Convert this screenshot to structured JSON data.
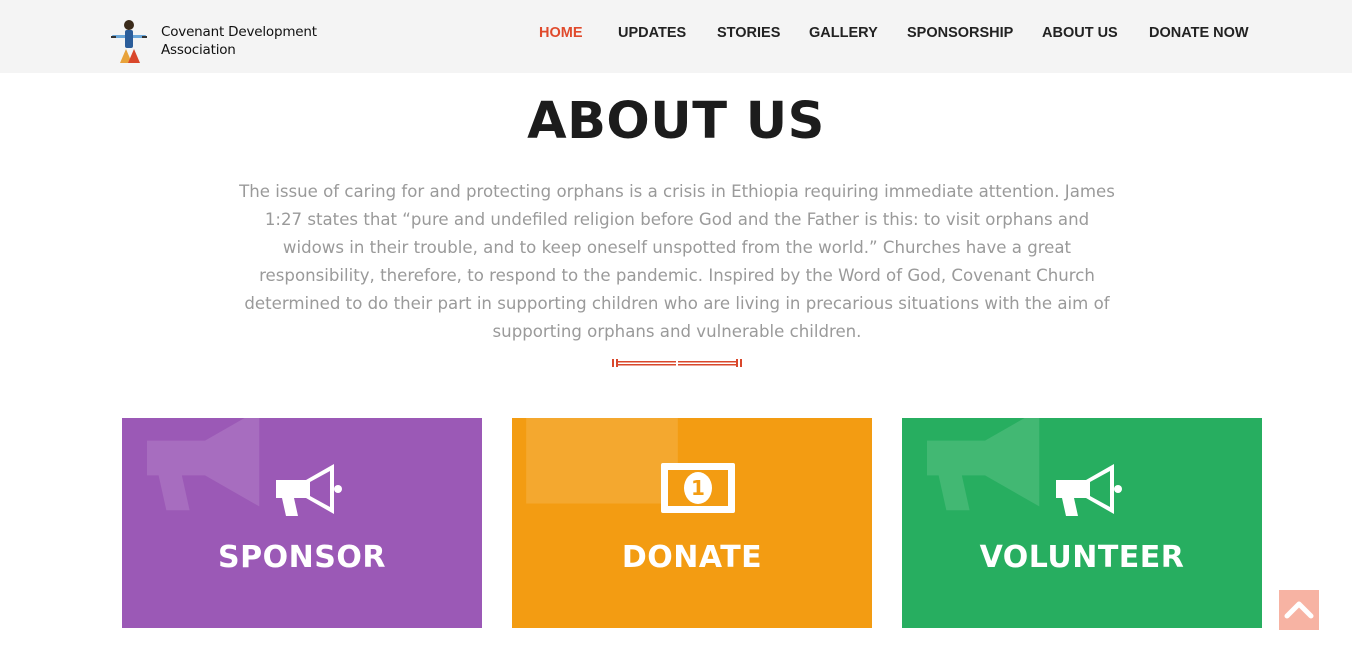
{
  "header": {
    "logo_line1": "Covenant Development",
    "logo_line2": "Association",
    "nav": [
      {
        "label": "HOME",
        "active": true
      },
      {
        "label": "UPDATES",
        "active": false
      },
      {
        "label": "STORIES",
        "active": false
      },
      {
        "label": "GALLERY",
        "active": false
      },
      {
        "label": "SPONSORSHIP",
        "active": false
      },
      {
        "label": "ABOUT US",
        "active": false
      },
      {
        "label": "DONATE NOW",
        "active": false
      }
    ]
  },
  "about": {
    "title": "ABOUT US",
    "text": "The issue of caring for and protecting orphans is a crisis in Ethiopia requiring immediate attention. James 1:27 states that “pure and undefiled religion before God and the Father is this: to visit orphans and widows in their trouble, and to keep oneself unspotted from the world.” Churches have a great responsibility, therefore, to respond to the pandemic. Inspired by the Word of God, Covenant Church determined to do their part in supporting children who are living in precarious situations with the aim of supporting orphans and vulnerable children."
  },
  "cards": [
    {
      "label": "SPONSOR",
      "color": "#9b59b6",
      "icon": "megaphone-icon"
    },
    {
      "label": "DONATE",
      "color": "#f39c12",
      "icon": "banknote-icon"
    },
    {
      "label": "VOLUNTEER",
      "color": "#27ae60",
      "icon": "megaphone-icon"
    }
  ],
  "colors": {
    "accent": "#e04a2c",
    "header_bg": "#f4f4f4",
    "back_to_top": "#f7b3a3"
  }
}
